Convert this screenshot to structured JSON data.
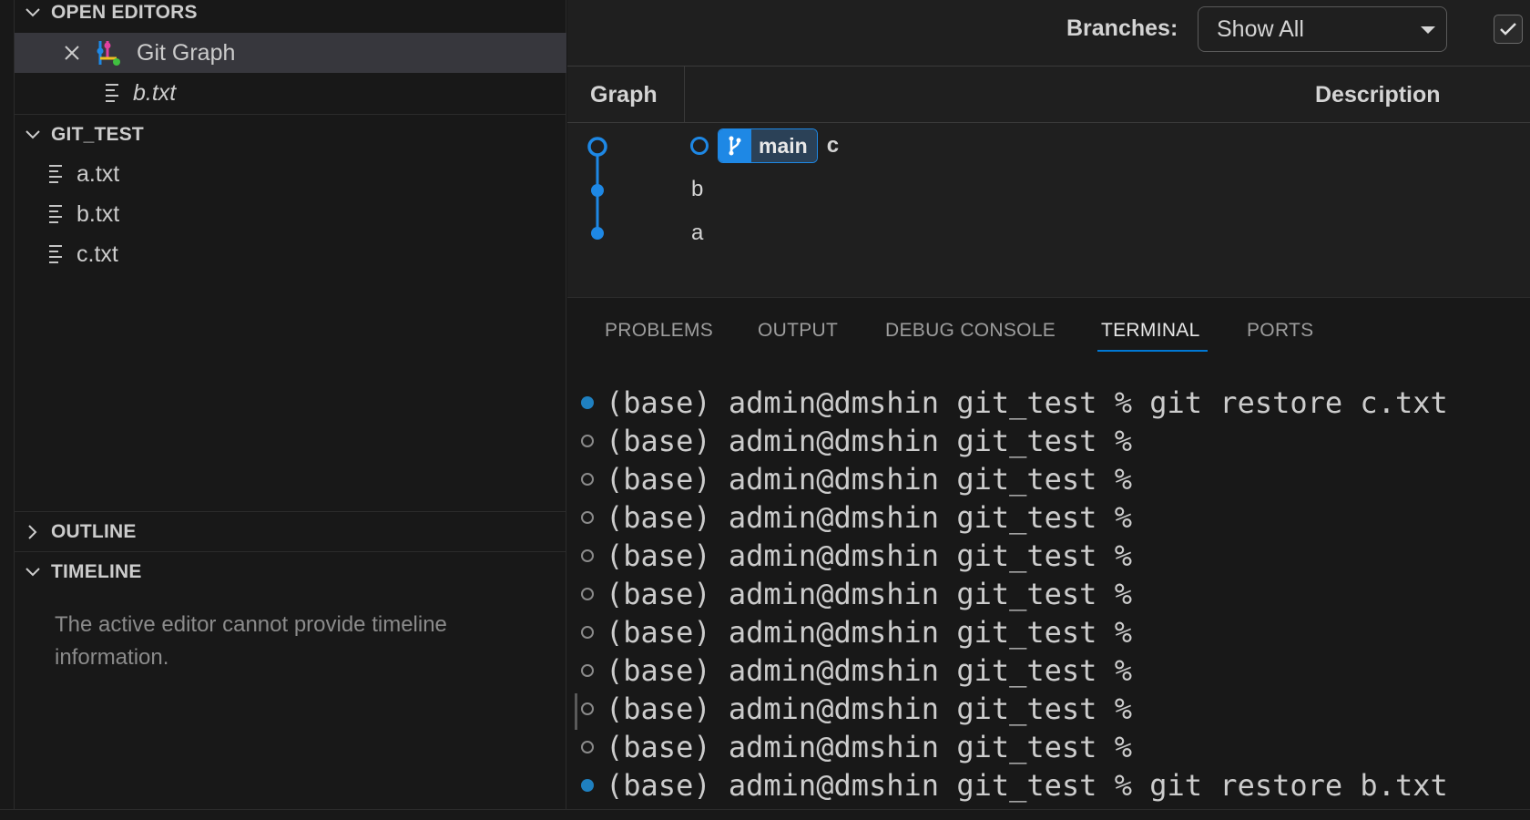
{
  "sidebar": {
    "open_editors": {
      "header": "OPEN EDITORS",
      "items": [
        {
          "label": "Git Graph",
          "active": true
        },
        {
          "label": "b.txt"
        }
      ]
    },
    "folder": {
      "header": "GIT_TEST",
      "files": [
        "a.txt",
        "b.txt",
        "c.txt"
      ]
    },
    "outline": {
      "header": "OUTLINE"
    },
    "timeline": {
      "header": "TIMELINE",
      "message": "The active editor cannot provide timeline information."
    }
  },
  "git_graph": {
    "branches_label": "Branches:",
    "branches_value": "Show All",
    "columns": {
      "graph": "Graph",
      "description": "Description"
    },
    "commits": [
      {
        "message": "c",
        "branch": "main",
        "head": true
      },
      {
        "message": "b"
      },
      {
        "message": "a"
      }
    ],
    "colors": {
      "graph": "#1e88e5"
    }
  },
  "panel": {
    "tabs": [
      "PROBLEMS",
      "OUTPUT",
      "DEBUG CONSOLE",
      "TERMINAL",
      "PORTS"
    ],
    "active_tab": "TERMINAL",
    "terminal": {
      "lines": [
        {
          "text": "(base) admin@dmshin git_test % git restore c.txt",
          "status": "filled"
        },
        {
          "text": "(base) admin@dmshin git_test %",
          "status": "hollow"
        },
        {
          "text": "(base) admin@dmshin git_test %",
          "status": "hollow"
        },
        {
          "text": "(base) admin@dmshin git_test %",
          "status": "hollow"
        },
        {
          "text": "(base) admin@dmshin git_test %",
          "status": "hollow"
        },
        {
          "text": "(base) admin@dmshin git_test %",
          "status": "hollow"
        },
        {
          "text": "(base) admin@dmshin git_test %",
          "status": "hollow"
        },
        {
          "text": "(base) admin@dmshin git_test %",
          "status": "hollow"
        },
        {
          "text": "(base) admin@dmshin git_test %",
          "status": "hollow"
        },
        {
          "text": "(base) admin@dmshin git_test %",
          "status": "hollow"
        },
        {
          "text": "(base) admin@dmshin git_test % git restore b.txt",
          "status": "filled"
        }
      ]
    }
  }
}
